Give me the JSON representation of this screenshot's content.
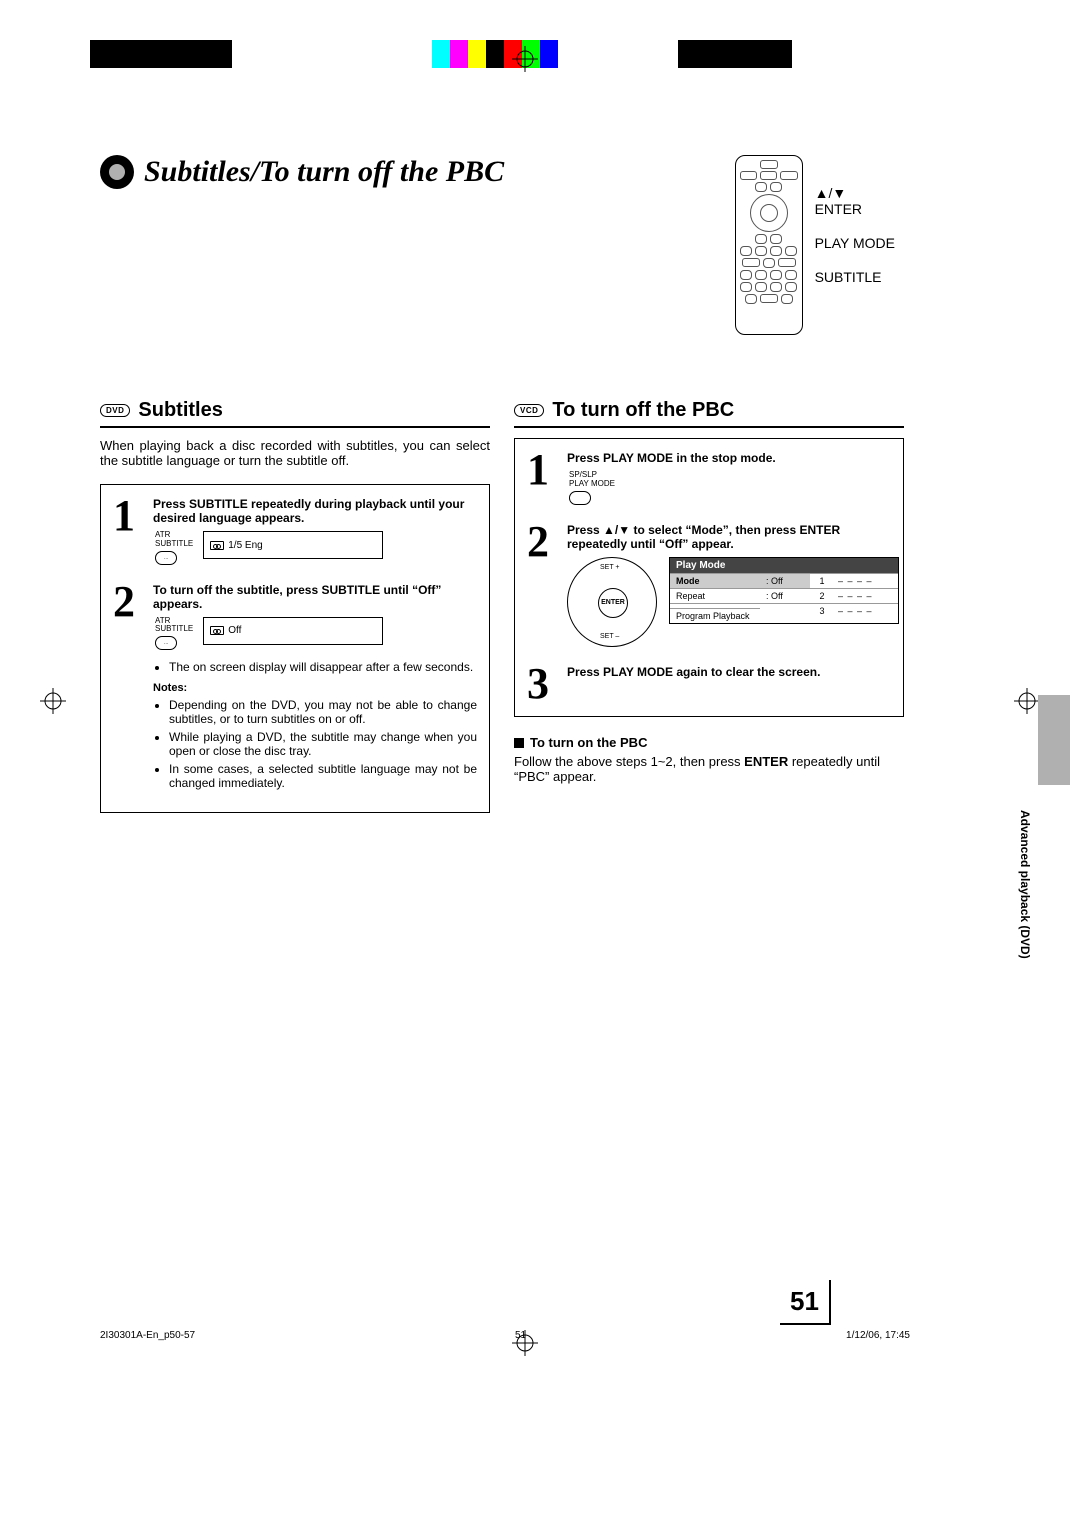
{
  "page": {
    "title": "Subtitles/To turn off the PBC",
    "number": "51",
    "section_tab": "Advanced playback (DVD)"
  },
  "remote_labels": {
    "enter": "▲/▼\nENTER",
    "playmode": "PLAY MODE",
    "subtitle": "SUBTITLE"
  },
  "left": {
    "badge": "DVD",
    "heading": "Subtitles",
    "intro": "When playing back a disc recorded with subtitles, you can select the subtitle language or turn the subtitle off.",
    "step1": {
      "title": "Press SUBTITLE repeatedly during playback until your desired language appears.",
      "icon_top": "ATR",
      "icon_bottom": "SUBTITLE",
      "osd": "1/5 Eng"
    },
    "step2": {
      "title": "To turn off the subtitle, press SUBTITLE until “Off” appears.",
      "icon_top": "ATR",
      "icon_bottom": "SUBTITLE",
      "osd": "Off",
      "bullet": "The on screen display will disappear after a few seconds."
    },
    "notes_label": "Notes:",
    "notes": [
      "Depending on the DVD, you may not be able to change subtitles, or to turn subtitles on or off.",
      "While playing a DVD, the subtitle may change when you open or close the disc tray.",
      "In some cases, a selected subtitle language may not be changed immediately."
    ]
  },
  "right": {
    "badge": "VCD",
    "heading": "To turn off the PBC",
    "step1": {
      "title": "Press PLAY MODE in the stop mode.",
      "icon_top": "SP/SLP",
      "icon_bottom": "PLAY MODE"
    },
    "step2": {
      "title": "Press ▲/▼ to select “Mode”, then press ENTER repeatedly until “Off” appear.",
      "dpad_center": "ENTER",
      "dpad_top": "SET +",
      "dpad_bottom": "SET –",
      "osd_title": "Play Mode",
      "osd_rows": {
        "labels": [
          "Mode",
          "Repeat",
          "Program Playback"
        ],
        "vals": [
          ": Off",
          ": Off",
          ""
        ],
        "nums": [
          "1",
          "2",
          "3"
        ],
        "slots": [
          "– –  – –",
          "– –  – –",
          "– –  – –"
        ]
      }
    },
    "step3": {
      "title": "Press PLAY MODE again to clear the screen."
    },
    "turnon": {
      "heading": "To turn on the PBC",
      "body_a": "Follow the above steps 1~2, then press ",
      "body_b": "ENTER",
      "body_c": " repeatedly until “PBC” appear."
    }
  },
  "footer": {
    "file": "2I30301A-En_p50-57",
    "pg": "51",
    "date": "1/12/06, 17:45"
  },
  "colors": {
    "swatches_top": [
      "#000",
      "#000",
      "#000",
      "#000",
      "#000",
      "#000",
      "#0ff",
      "#f0f",
      "#ff0",
      "#000",
      "#f00",
      "#0f0",
      "#00f",
      "#000",
      "#000",
      "#000",
      "#000",
      "#000"
    ]
  }
}
